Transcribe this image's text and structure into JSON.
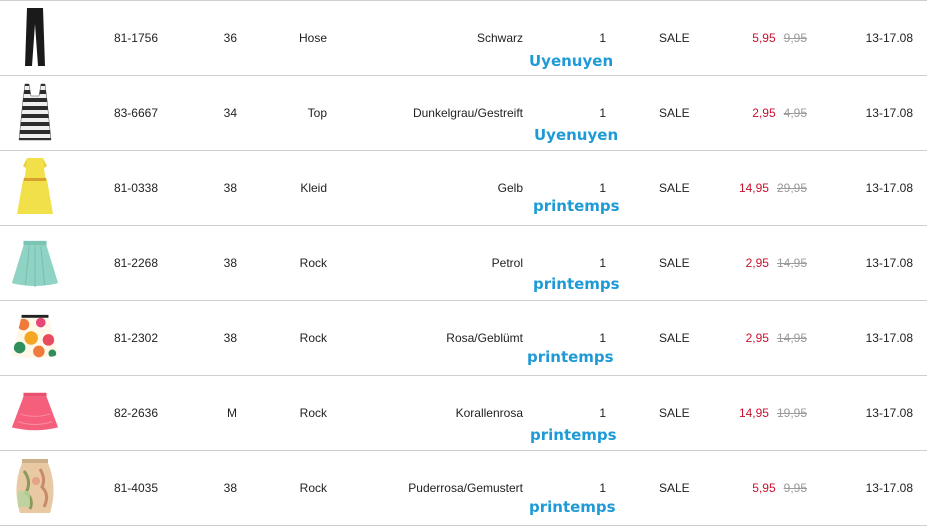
{
  "rows": [
    {
      "art": "81-1756",
      "size": "36",
      "type": "Hose",
      "color": "Schwarz",
      "qty": "1",
      "status": "SALE",
      "price_now": "5,95",
      "price_old": "9,95",
      "dates": "13-17.08",
      "watermark": "Uyenuyen",
      "icon": "black-pants-icon",
      "swatch": "#1a1a1a"
    },
    {
      "art": "83-6667",
      "size": "34",
      "type": "Top",
      "color": "Dunkelgrau/Gestreift",
      "qty": "1",
      "status": "SALE",
      "price_now": "2,95",
      "price_old": "4,95",
      "dates": "13-17.08",
      "watermark": "Uyenuyen",
      "icon": "striped-tank-top-icon",
      "swatch": "#3a3a3a"
    },
    {
      "art": "81-0338",
      "size": "38",
      "type": "Kleid",
      "color": "Gelb",
      "qty": "1",
      "status": "SALE",
      "price_now": "14,95",
      "price_old": "29,95",
      "dates": "13-17.08",
      "watermark": "printemps",
      "icon": "yellow-dress-icon",
      "swatch": "#f2e04a"
    },
    {
      "art": "81-2268",
      "size": "38",
      "type": "Rock",
      "color": "Petrol",
      "qty": "1",
      "status": "SALE",
      "price_now": "2,95",
      "price_old": "14,95",
      "dates": "13-17.08",
      "watermark": "printemps",
      "icon": "petrol-skirt-icon",
      "swatch": "#8fd3c4"
    },
    {
      "art": "81-2302",
      "size": "38",
      "type": "Rock",
      "color": "Rosa/Geblümt",
      "qty": "1",
      "status": "SALE",
      "price_now": "2,95",
      "price_old": "14,95",
      "dates": "13-17.08",
      "watermark": "printemps",
      "icon": "floral-skirt-icon",
      "swatch": "#f07a3a"
    },
    {
      "art": "82-2636",
      "size": "M",
      "type": "Rock",
      "color": "Korallenrosa",
      "qty": "1",
      "status": "SALE",
      "price_now": "14,95",
      "price_old": "19,95",
      "dates": "13-17.08",
      "watermark": "printemps",
      "icon": "coral-skirt-icon",
      "swatch": "#f55f7c"
    },
    {
      "art": "81-4035",
      "size": "38",
      "type": "Rock",
      "color": "Puderrosa/Gemustert",
      "qty": "1",
      "status": "SALE",
      "price_now": "5,95",
      "price_old": "9,95",
      "dates": "13-17.08",
      "watermark": "printemps",
      "icon": "patterned-skirt-icon",
      "swatch": "#e9c9a4"
    }
  ],
  "colors": {
    "sale_price": "#c8102e",
    "old_price": "#9a9a9a",
    "watermark": "#1e9bd7",
    "divider": "#cfcfcf"
  }
}
